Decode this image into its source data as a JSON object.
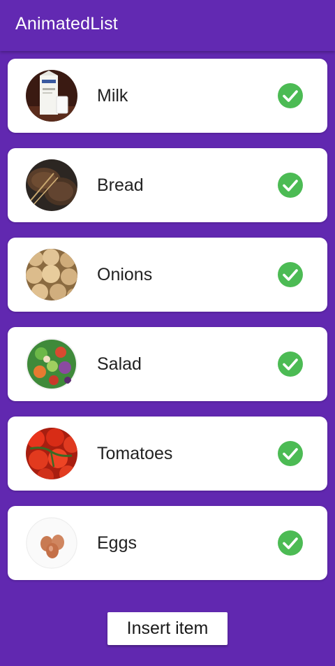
{
  "app_bar": {
    "title": "AnimatedList"
  },
  "items": [
    {
      "label": "Milk",
      "image": "milk-carton-and-glass",
      "checked": true
    },
    {
      "label": "Bread",
      "image": "bread-loaves",
      "checked": true
    },
    {
      "label": "Onions",
      "image": "onions-pile",
      "checked": true
    },
    {
      "label": "Salad",
      "image": "salad-bowl",
      "checked": true
    },
    {
      "label": "Tomatoes",
      "image": "tomatoes-on-vine",
      "checked": true
    },
    {
      "label": "Eggs",
      "image": "eggs",
      "checked": true
    }
  ],
  "insert_button": {
    "label": "Insert item"
  },
  "colors": {
    "background": "#6128b0",
    "app_bar": "#6229b2",
    "card": "#ffffff",
    "check": "#4cbb54"
  }
}
